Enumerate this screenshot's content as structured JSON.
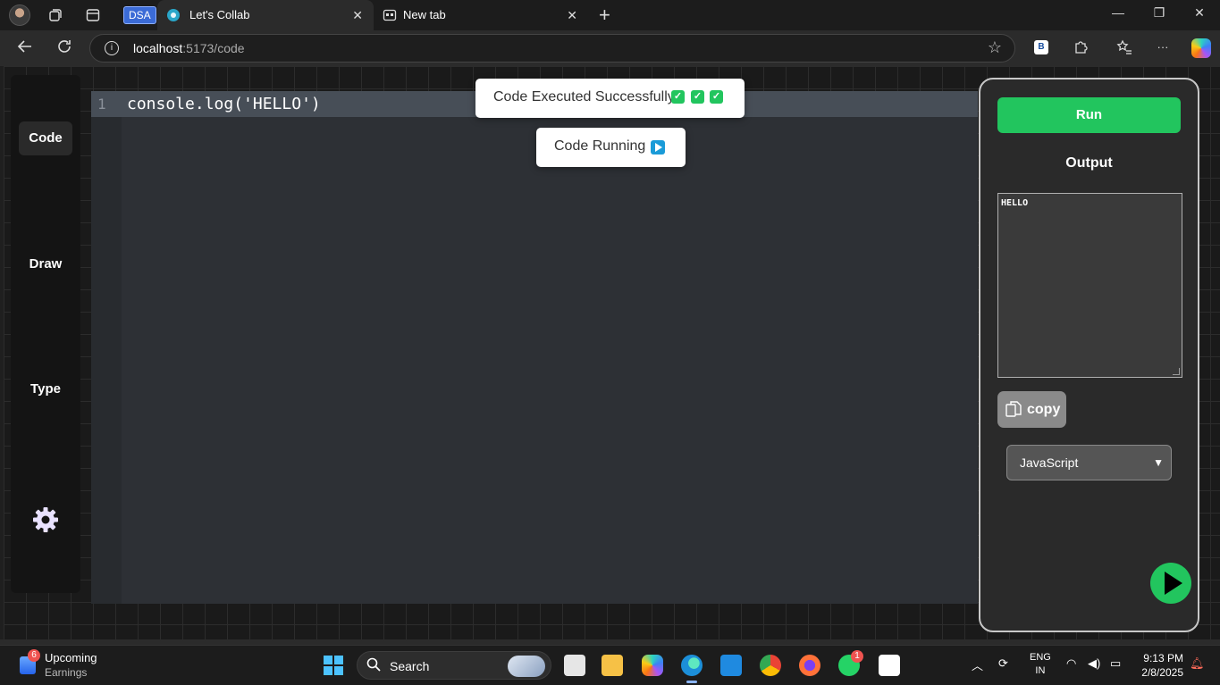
{
  "browser": {
    "tab_group_label": "DSA",
    "tabs": [
      {
        "title": "Let's Collab",
        "active": true
      },
      {
        "title": "New tab",
        "active": false
      }
    ],
    "address": {
      "host": "localhost",
      "path": ":5173/code"
    }
  },
  "sidebar": {
    "items": [
      {
        "label": "Code",
        "active": true
      },
      {
        "label": "Draw",
        "active": false
      },
      {
        "label": "Type",
        "active": false
      }
    ],
    "settings_icon": "gear-icon"
  },
  "editor": {
    "line_number": "1",
    "code": "console.log('HELLO')"
  },
  "toasts": {
    "success": "Code Executed Successfully",
    "running": "Code Running"
  },
  "panel": {
    "run_label": "Run",
    "output_label": "Output",
    "output_text": "HELLO",
    "copy_label": "copy",
    "language": "JavaScript"
  },
  "colors": {
    "accent_green": "#22c55e",
    "editor_bg": "#2d3035",
    "panel_bg": "#2a2a2a"
  },
  "taskbar": {
    "widget_badge": "6",
    "widget_title": "Upcoming",
    "widget_subtitle": "Earnings",
    "search_label": "Search",
    "whatsapp_badge": "1",
    "lang_line1": "ENG",
    "lang_line2": "IN",
    "time": "9:13 PM",
    "date": "2/8/2025"
  }
}
